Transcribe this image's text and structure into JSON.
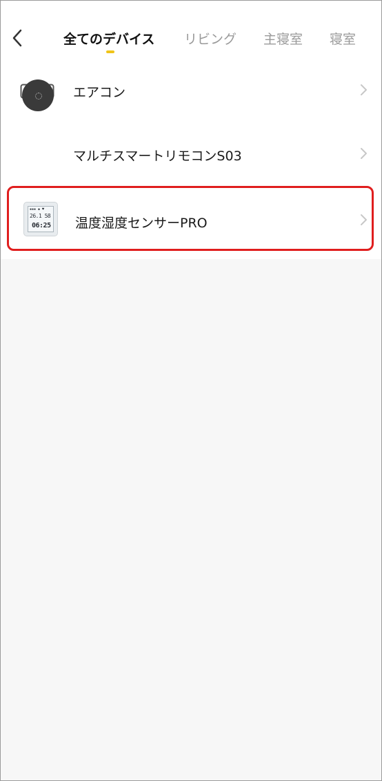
{
  "header": {
    "back_icon": "chevron-left-icon",
    "tabs": [
      {
        "label": "全てのデバイス",
        "active": true
      },
      {
        "label": "リビング",
        "active": false
      },
      {
        "label": "主寝室",
        "active": false
      },
      {
        "label": "寝室",
        "active": false
      }
    ],
    "indicator_color": "#f0c419"
  },
  "devices": [
    {
      "name": "エアコン",
      "icon": "air-conditioner-icon"
    },
    {
      "name": "マルチスマートリモコンS03",
      "icon": "remote-icon"
    },
    {
      "name": "温度湿度センサーPRO",
      "icon": "thermo-hygrometer-icon",
      "highlighted": true
    }
  ],
  "sensor_display": {
    "temperature": "26.1",
    "humidity": "58",
    "clock": "06:25"
  },
  "colors": {
    "highlight": "#e01e1e",
    "background": "#f7f7f7"
  }
}
